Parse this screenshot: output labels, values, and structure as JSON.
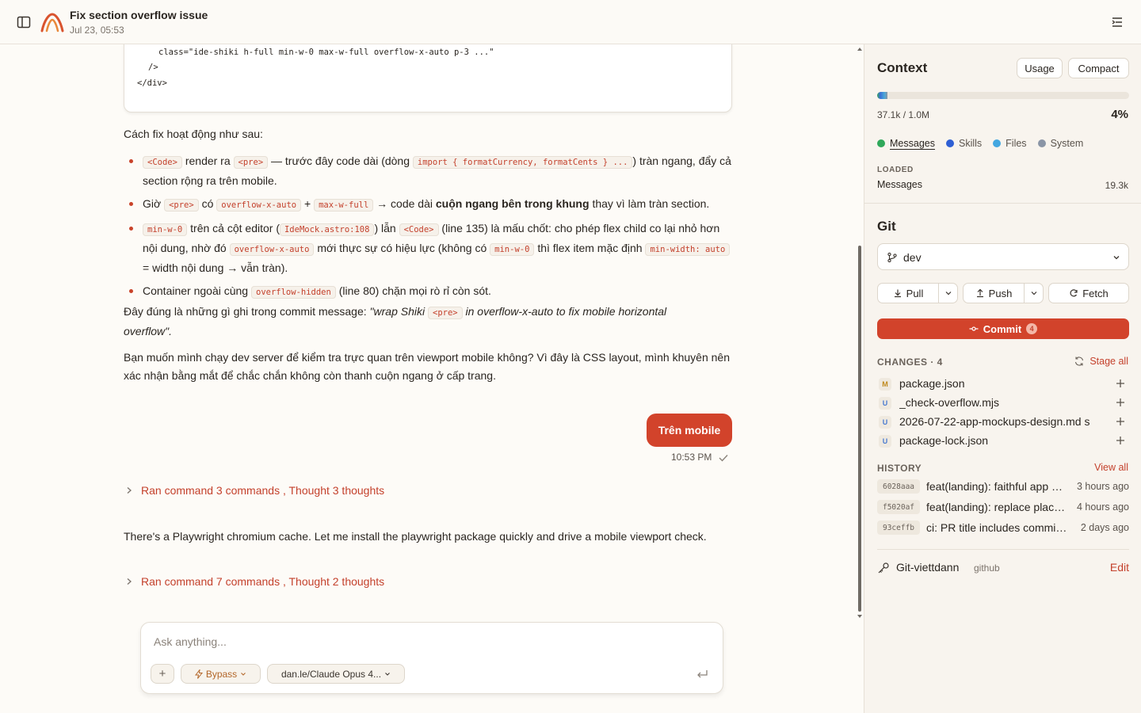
{
  "header": {
    "title": "Fix section overflow issue",
    "date": "Jul 23, 05:53"
  },
  "colors": {
    "accent": "#d2432b",
    "link": "#c4412c"
  },
  "code_lines": [
    "...",
    "class=\"ide-shiki h-full min-w-0 max-w-full overflow-x-auto p-3 ...\"",
    "/>",
    "</div>"
  ],
  "message": {
    "intro": "Cách fix hoạt động như sau:",
    "b1": {
      "c1": "<Code>",
      "t1": "render ra",
      "c2": "<pre>",
      "t2": "— trước đây code dài (dòng",
      "c3": "import { formatCurrency, formatCents } ...",
      "t3": ") tràn ngang, đẩy cả section rộng ra trên mobile."
    },
    "b2": {
      "t0": "Giờ",
      "c1": "<pre>",
      "t1": "có",
      "c2": "overflow-x-auto",
      "t2": "+",
      "c3": "max-w-full",
      "t3": "→ code dài",
      "strong": "cuộn ngang bên trong khung",
      "t4": "thay vì làm tràn section."
    },
    "b3": {
      "c1": "min-w-0",
      "t1": "trên cả cột editor (",
      "c2": "IdeMock.astro:108",
      "t2": ") lẫn",
      "c3": "<Code>",
      "t3": "(line 135) là mấu chốt: cho phép flex child co lại nhỏ hơn nội dung, nhờ đó",
      "c4": "overflow-x-auto",
      "t4": "mới thực sự có hiệu lực (không có",
      "c5": "min-w-0",
      "t5": "thì flex item mặc định",
      "c6": "min-width: auto",
      "t6": "= width nội dung → vẫn tràn)."
    },
    "b4": {
      "t0": "Container ngoài cùng",
      "c1": "overflow-hidden",
      "t1": "(line 80) chặn mọi rò rỉ còn sót."
    },
    "commit_prefix": "Đây đúng là những gì ghi trong commit message:",
    "commit_quote_a": "\"wrap Shiki",
    "commit_code": "<pre>",
    "commit_quote_b": "in overflow-x-auto to fix mobile horizontal overflow\".",
    "question": "Bạn muốn mình chạy dev server để kiểm tra trực quan trên viewport mobile không? Vì đây là CSS layout, mình khuyên nên xác nhận bằng mắt để chắc chắn không còn thanh cuộn ngang ở cấp trang."
  },
  "user_message": {
    "text": "Trên mobile",
    "time": "10:53 PM"
  },
  "activity1": {
    "label": "Ran command 3 commands , Thought 3 thoughts"
  },
  "assistant2": "There's a Playwright chromium cache. Let me install the playwright package quickly and drive a mobile viewport check.",
  "activity2": {
    "label": "Ran command 7 commands , Thought 2 thoughts"
  },
  "composer": {
    "placeholder": "Ask anything...",
    "mode": "Bypass",
    "model": "dan.le/Claude Opus 4..."
  },
  "context": {
    "title": "Context",
    "usage_label": "Usage",
    "compact_label": "Compact",
    "fill_percent": 4,
    "count": "37.1k / 1.0M",
    "percent": "4%",
    "legend": [
      {
        "label": "Messages",
        "color": "#2fa85a"
      },
      {
        "label": "Skills",
        "color": "#2f5fd4"
      },
      {
        "label": "Files",
        "color": "#44a7e0"
      },
      {
        "label": "System",
        "color": "#8a95a6"
      }
    ],
    "loaded_label": "LOADED",
    "loaded_name": "Messages",
    "loaded_value": "19.3k"
  },
  "git": {
    "title": "Git",
    "branch": "dev",
    "pull": "Pull",
    "push": "Push",
    "fetch": "Fetch",
    "commit": "Commit",
    "commit_count": "4",
    "changes_label": "CHANGES · 4",
    "stage_all": "Stage all",
    "changes": [
      {
        "status": "M",
        "status_color": "#c08a1e",
        "file": "package.json"
      },
      {
        "status": "U",
        "status_color": "#4a7bd0",
        "file": "_check-overflow.mjs"
      },
      {
        "status": "U",
        "status_color": "#4a7bd0",
        "file": "2026-07-22-app-mockups-design.md s"
      },
      {
        "status": "U",
        "status_color": "#4a7bd0",
        "file": "package-lock.json"
      }
    ],
    "history_label": "HISTORY",
    "view_all": "View all",
    "history": [
      {
        "sha": "6028aaa",
        "message": "feat(landing): faithful app mockups",
        "when": "3 hours ago"
      },
      {
        "sha": "f5020af",
        "message": "feat(landing): replace placeholders",
        "when": "4 hours ago"
      },
      {
        "sha": "93ceffb",
        "message": "ci: PR title includes commit count",
        "when": "2 days ago"
      }
    ],
    "account_name": "Git-viettdann",
    "account_provider": "github",
    "edit": "Edit"
  }
}
